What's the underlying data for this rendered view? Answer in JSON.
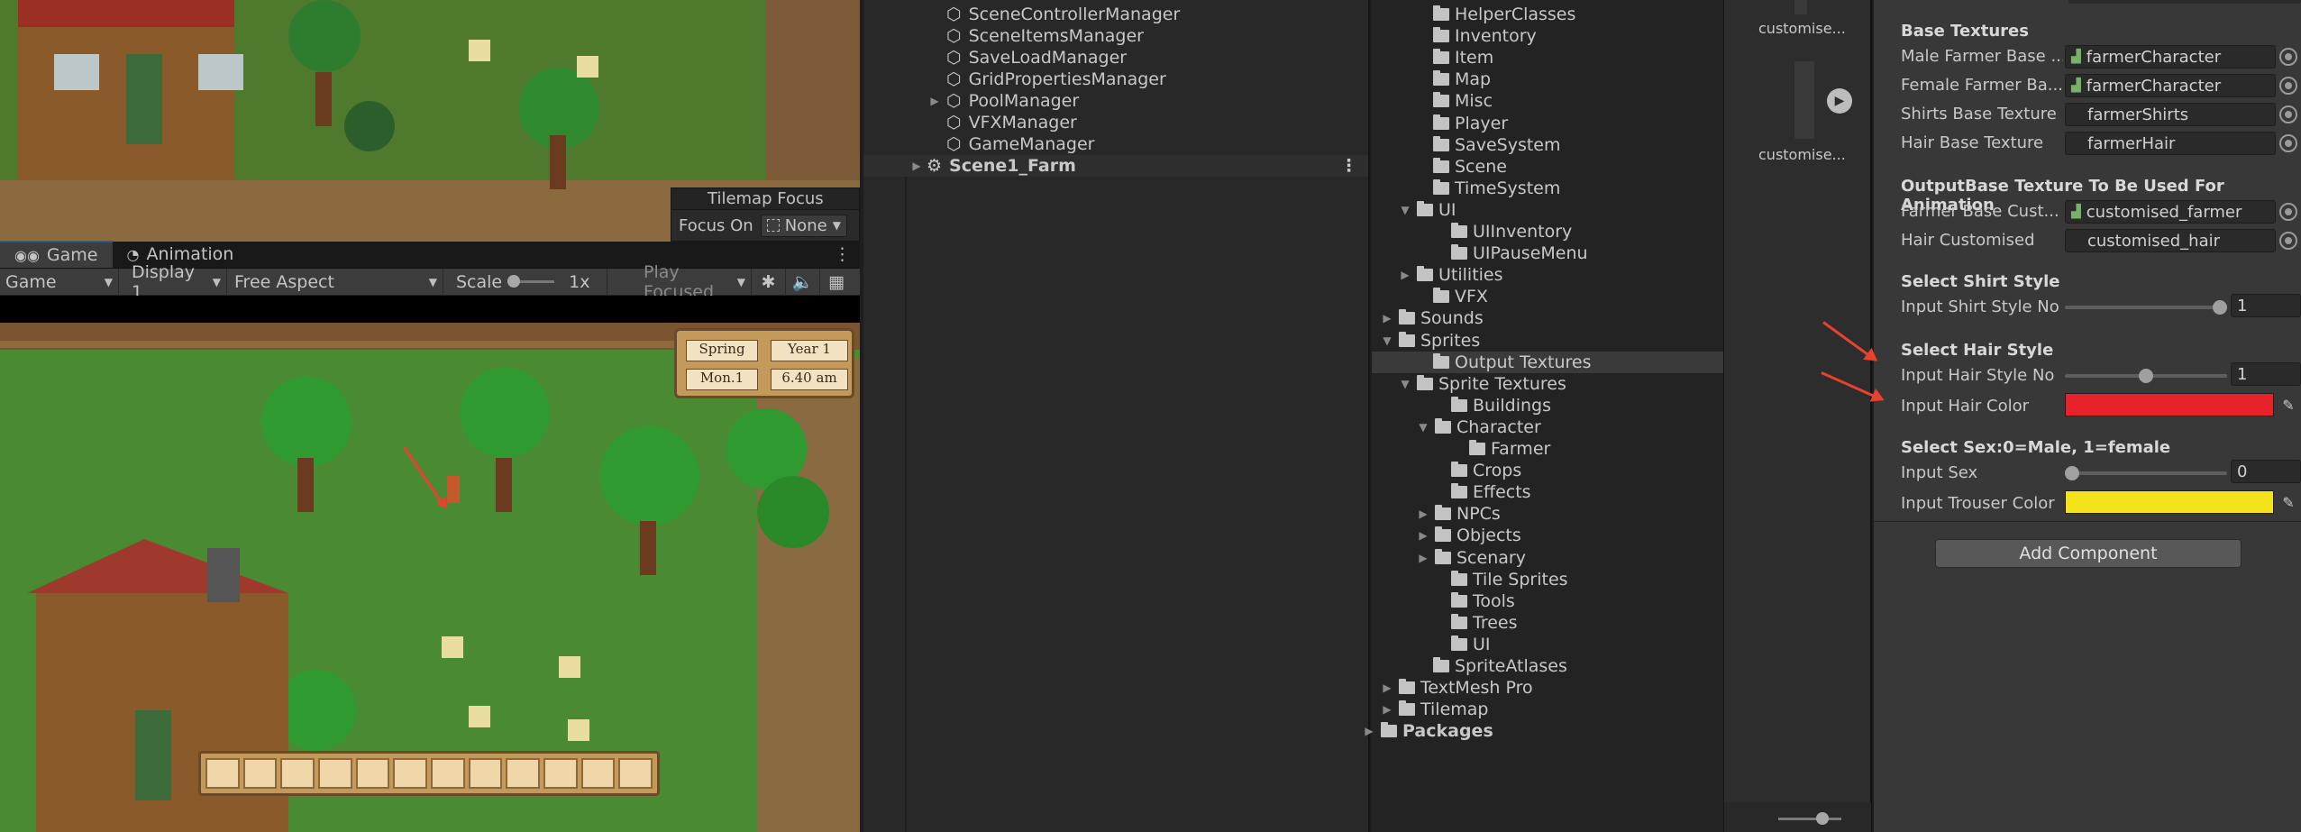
{
  "scene_view": {
    "tilemap_focus": {
      "title": "Tilemap Focus",
      "label": "Focus On",
      "value": "None"
    }
  },
  "game_panel": {
    "tabs": [
      {
        "label": "Game"
      },
      {
        "label": "Animation"
      }
    ],
    "toolbar": {
      "mode": "Game",
      "display": "Display 1",
      "aspect": "Free Aspect",
      "scale_label": "Scale",
      "scale_value": "1x",
      "play_focused": "Play Focused"
    },
    "hud": {
      "season": "Spring",
      "year": "Year 1",
      "day": "Mon.1",
      "time": "6.40 am"
    }
  },
  "hierarchy": {
    "items": [
      {
        "label": "SceneControllerManager"
      },
      {
        "label": "SceneItemsManager"
      },
      {
        "label": "SaveLoadManager"
      },
      {
        "label": "GridPropertiesManager"
      },
      {
        "label": "PoolManager"
      },
      {
        "label": "VFXManager"
      },
      {
        "label": "GameManager"
      }
    ],
    "scene": {
      "label": "Scene1_Farm"
    }
  },
  "project": {
    "folders": [
      "HelperClasses",
      "Inventory",
      "Item",
      "Map",
      "Misc",
      "Player",
      "SaveSystem",
      "Scene",
      "TimeSystem",
      "UI",
      "UIInventory",
      "UIPauseMenu",
      "Utilities",
      "VFX",
      "Sounds",
      "Sprites",
      "Output Textures",
      "Sprite Textures",
      "Buildings",
      "Character",
      "Farmer",
      "Crops",
      "Effects",
      "NPCs",
      "Objects",
      "Scenary",
      "Tile Sprites",
      "Tools",
      "Trees",
      "UI",
      "SpriteAtlases",
      "TextMesh Pro",
      "Tilemap",
      "Packages"
    ],
    "preview_items": [
      "customise...",
      "customise..."
    ]
  },
  "inspector": {
    "base_textures_header": "Base Textures",
    "male_label": "Male Farmer Base ...",
    "male_value": "farmerCharacter",
    "female_label": "Female Farmer Ba...",
    "female_value": "farmerCharacter",
    "shirts_label": "Shirts Base Texture",
    "shirts_value": "farmerShirts",
    "hair_label": "Hair Base Texture",
    "hair_value": "farmerHair",
    "output_header": "OutputBase Texture To Be Used For Animation",
    "farmer_custom_label": "Farmer Base Cust...",
    "farmer_custom_value": "customised_farmer",
    "hair_custom_label": "Hair Customised",
    "hair_custom_value": "customised_hair",
    "shirt_header": "Select Shirt Style",
    "shirt_no_label": "Input Shirt Style No",
    "shirt_no_value": "1",
    "shirt_slider_fraction": 1.0,
    "hair_header": "Select Hair Style",
    "hair_no_label": "Input Hair Style No",
    "hair_no_value": "1",
    "hair_slider_fraction": 0.5,
    "hair_color_label": "Input Hair Color",
    "hair_color": "#e8222a",
    "sex_header": "Select Sex:0=Male, 1=female",
    "sex_label": "Input Sex",
    "sex_value": "0",
    "sex_slider_fraction": 0.0,
    "trouser_label": "Input Trouser Color",
    "trouser_color": "#f4e21a",
    "add_component": "Add Component"
  }
}
